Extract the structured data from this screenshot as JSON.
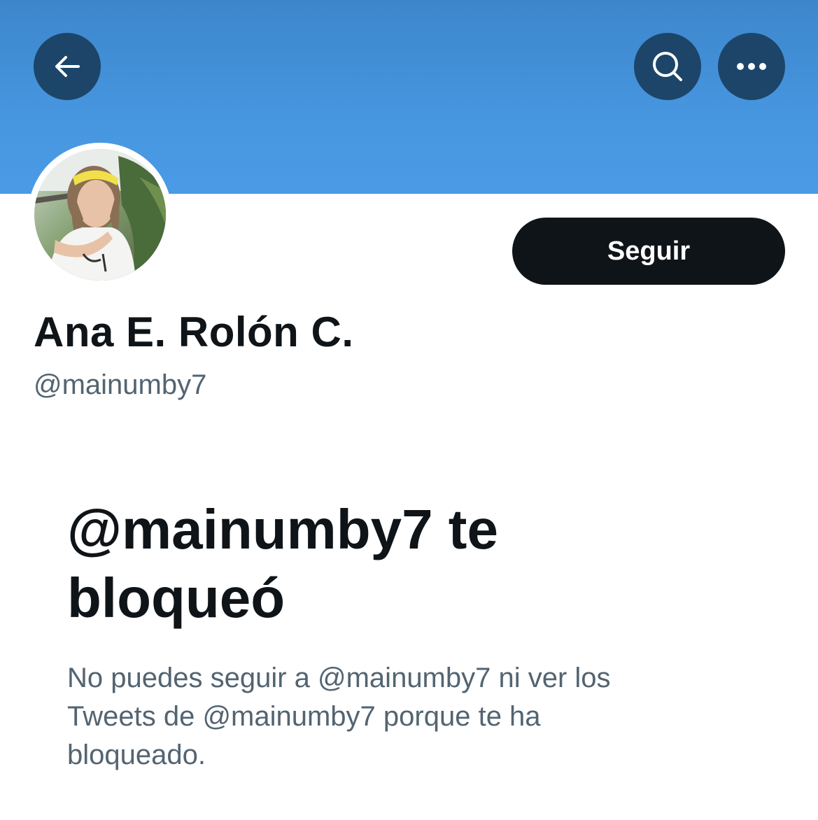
{
  "header": {
    "back_icon": "arrow-left-icon",
    "search_icon": "search-icon",
    "more_icon": "more-horizontal-icon",
    "banner_color": "#4696df",
    "button_color": "#1d4569"
  },
  "profile": {
    "display_name": "Ana E. Rolón C.",
    "handle": "@mainumby7",
    "follow_label": "Seguir"
  },
  "blocked": {
    "title": "@mainumby7 te bloqueó",
    "description": "No puedes seguir a @mainumby7 ni ver los Tweets de @mainumby7 porque te ha bloqueado."
  },
  "colors": {
    "primary_text": "#0f1419",
    "secondary_text": "#536471",
    "follow_button_bg": "#0f1419"
  }
}
